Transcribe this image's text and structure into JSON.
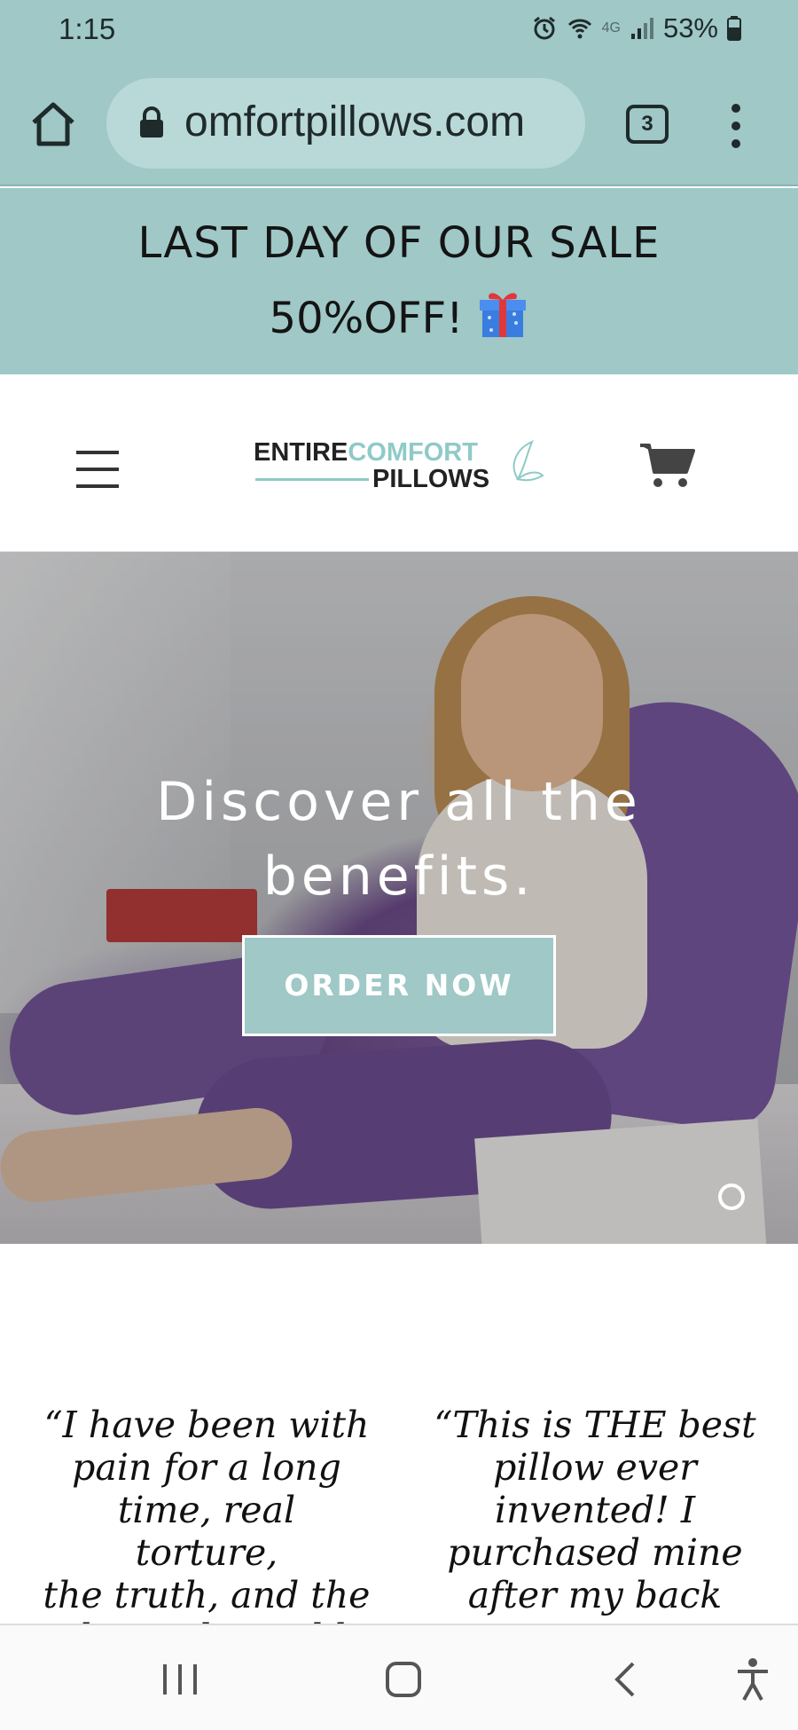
{
  "status_bar": {
    "time": "1:15",
    "battery": "53%",
    "network": "4G",
    "icons": [
      "alarm-icon",
      "wifi-icon",
      "signal-icon",
      "battery-icon"
    ]
  },
  "browser": {
    "url": "omfortpillows.com",
    "tab_count": "3",
    "icons": [
      "home-icon",
      "lock-icon",
      "tabs-icon",
      "overflow-menu-icon"
    ]
  },
  "banner": {
    "line1": "LAST DAY OF OUR SALE",
    "line2": "50%OFF!",
    "icon": "gift-icon"
  },
  "header": {
    "logo_entire": "ENTIRE",
    "logo_comfort": "COMFORT",
    "logo_pillows": "PILLOWS",
    "colors": {
      "accent": "#8fcac7",
      "dark": "#222222"
    }
  },
  "hero": {
    "headline_line1": "Discover all the",
    "headline_line2": "benefits.",
    "cta_label": "ORDER NOW"
  },
  "testimonials": [
    {
      "text_lines": [
        "“I have been with",
        "pain for a long",
        "time, real torture,",
        "the truth, and the",
        "doctor has told me"
      ]
    },
    {
      "text_lines": [
        "“This is THE best",
        "pillow ever",
        "invented! I",
        "purchased mine",
        "after my back"
      ]
    }
  ],
  "colors": {
    "banner_bg": "#9fc8c7",
    "url_bar_bg": "#b9d9d8",
    "button_bg": "#9fc8c7"
  }
}
